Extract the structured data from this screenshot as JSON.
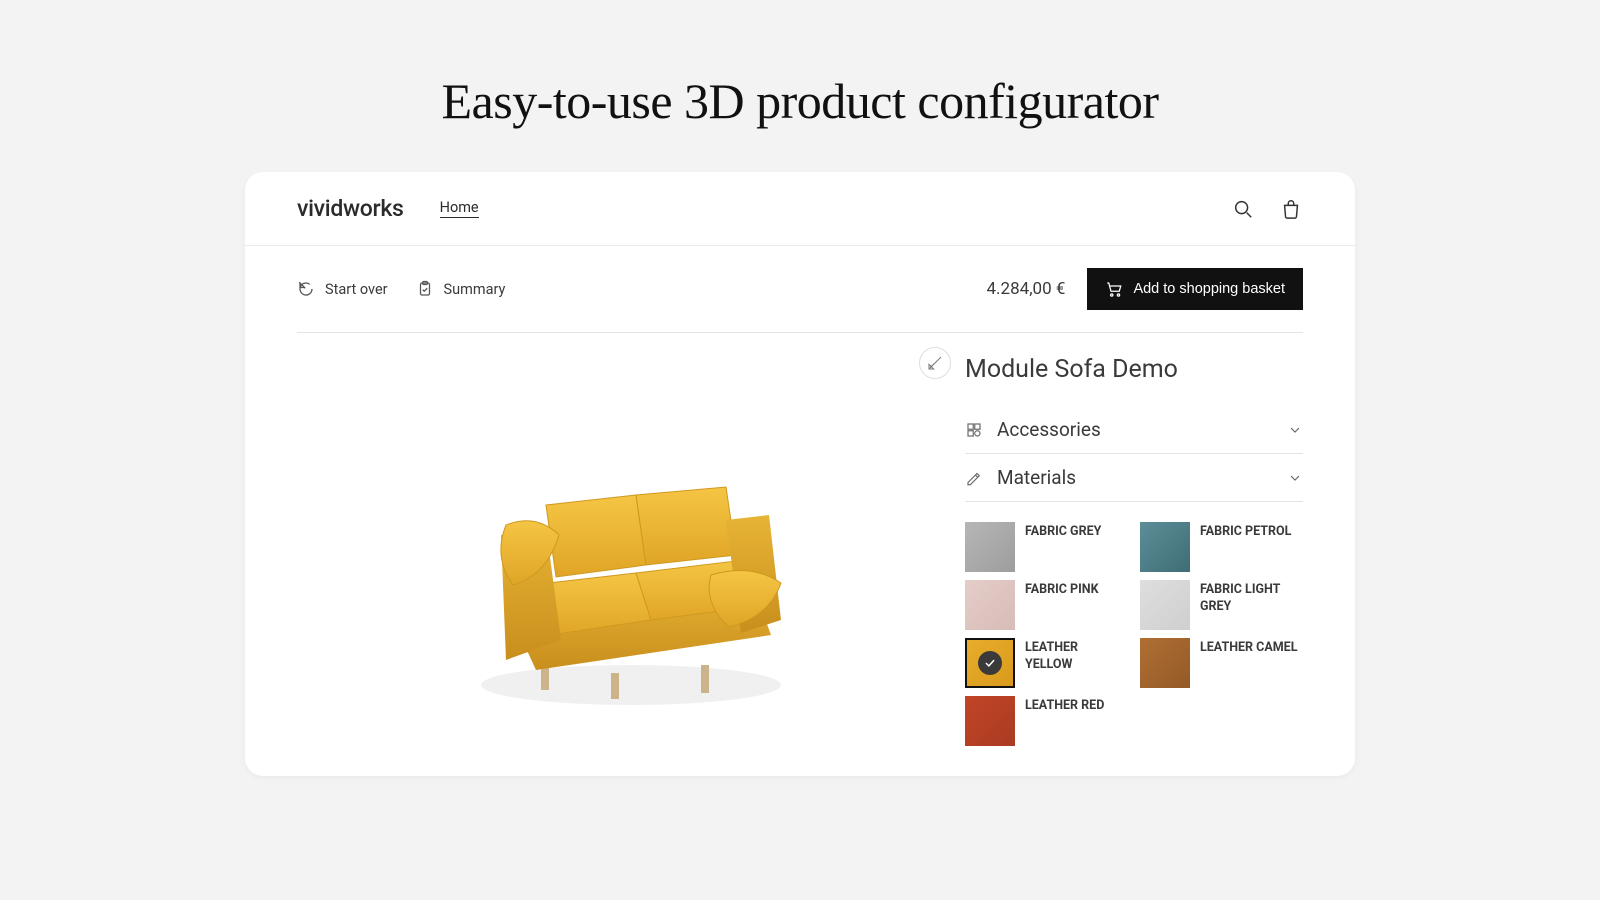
{
  "page": {
    "title": "Easy-to-use 3D product configurator"
  },
  "topbar": {
    "brand": "vividworks",
    "home": "Home"
  },
  "actions": {
    "start_over": "Start over",
    "summary": "Summary",
    "price": "4.284,00 €",
    "add_to_basket": "Add to shopping basket"
  },
  "product": {
    "name": "Module Sofa Demo"
  },
  "accordions": {
    "accessories": "Accessories",
    "materials": "Materials"
  },
  "materials": {
    "fabric_grey": {
      "label": "FABRIC GREY",
      "tex": "tex-grey",
      "selected": false
    },
    "fabric_petrol": {
      "label": "FABRIC PETROL",
      "tex": "tex-petrol",
      "selected": false
    },
    "fabric_pink": {
      "label": "FABRIC PINK",
      "tex": "tex-pink",
      "selected": false
    },
    "fabric_light_grey": {
      "label": "FABRIC LIGHT GREY",
      "tex": "tex-lightgrey",
      "selected": false
    },
    "leather_yellow": {
      "label": "LEATHER YELLOW",
      "tex": "tex-yellow",
      "selected": true
    },
    "leather_camel": {
      "label": "LEATHER CAMEL",
      "tex": "tex-camel",
      "selected": false
    },
    "leather_red": {
      "label": "LEATHER RED",
      "tex": "tex-red",
      "selected": false
    }
  },
  "icons": {
    "search": "search-icon",
    "bag": "shopping-bag-icon",
    "restart": "restart-icon",
    "clipboard": "clipboard-check-icon",
    "cart": "shopping-cart-icon",
    "ruler": "ruler-icon",
    "puzzle": "puzzle-icon",
    "palette": "palette-icon",
    "chevron": "chevron-down-icon",
    "check": "check-icon"
  }
}
